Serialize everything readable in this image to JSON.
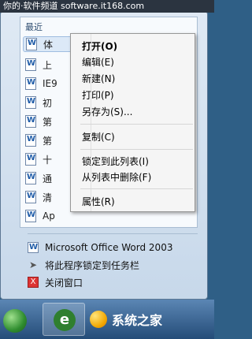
{
  "watermark": "你的·软件频道 software.it168.com",
  "jumplist": {
    "recent_header": "最近",
    "recent_items": [
      {
        "label": "体"
      },
      {
        "label": "上"
      },
      {
        "label": "IE9"
      },
      {
        "label": "初"
      },
      {
        "label": "第"
      },
      {
        "label": "第"
      },
      {
        "label": "十"
      },
      {
        "label": "通"
      },
      {
        "label": "清"
      },
      {
        "label": "Ap"
      }
    ],
    "tasks": [
      {
        "label": "Microsoft Office Word 2003",
        "icon": "word-icon"
      },
      {
        "label": "将此程序锁定到任务栏",
        "icon": "pin-icon"
      },
      {
        "label": "关闭窗口",
        "icon": "close-icon",
        "glyph": "X"
      }
    ]
  },
  "context_menu": {
    "items": [
      {
        "label": "打开(O)"
      },
      {
        "label": "编辑(E)"
      },
      {
        "label": "新建(N)"
      },
      {
        "label": "打印(P)"
      },
      {
        "label": "另存为(S)..."
      },
      {
        "label": "复制(C)"
      },
      {
        "label": "锁定到此列表(I)"
      },
      {
        "label": "从列表中删除(F)"
      },
      {
        "label": "属性(R)"
      }
    ]
  },
  "taskbar": {
    "ie_glyph": "e",
    "brand_text": "系统之家"
  }
}
